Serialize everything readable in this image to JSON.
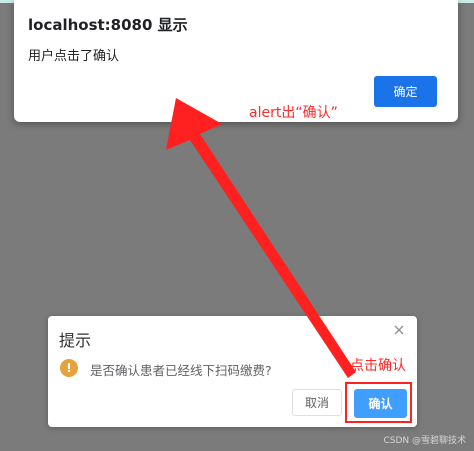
{
  "alert": {
    "title": "localhost:8080 显示",
    "message": "用户点击了确认",
    "ok_label": "确定"
  },
  "confirm": {
    "title": "提示",
    "message": "是否确认患者已经线下扫码缴费?",
    "cancel_label": "取消",
    "ok_label": "确认",
    "icon_char": "!"
  },
  "annotations": {
    "alert_note": "alert出“确认”",
    "click_note": "点击确认"
  },
  "watermark": "CSDN @雪碧聊技术",
  "colors": {
    "overlay": "#7b7b7b",
    "alert_button": "#1a73e8",
    "confirm_button": "#409eff",
    "warning": "#e6a23c",
    "annotation": "#ff2a2a"
  }
}
